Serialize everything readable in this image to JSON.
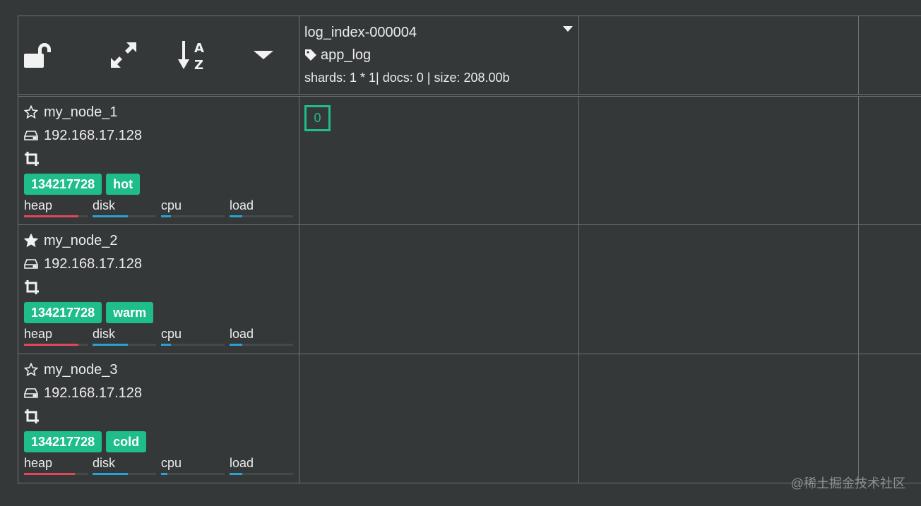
{
  "header": {
    "controls": [
      {
        "icon": "unlock-icon"
      },
      {
        "icon": "expand-icon"
      },
      {
        "icon": "sort-alpha-icon"
      },
      {
        "icon": "caret-down-icon"
      }
    ]
  },
  "index": {
    "name": "log_index-000004",
    "alias": "app_log",
    "stats": "shards: 1 * 1| docs: 0 | size: 208.00b"
  },
  "nodes": [
    {
      "name": "my_node_1",
      "ip": "192.168.17.128",
      "star": "outline",
      "id_badge": "134217728",
      "tier": "hot",
      "metrics": {
        "heap": 0.85,
        "disk": 0.55,
        "cpu": 0.15,
        "load": 0.2
      },
      "shard": "0"
    },
    {
      "name": "my_node_2",
      "ip": "192.168.17.128",
      "star": "filled",
      "id_badge": "134217728",
      "tier": "warm",
      "metrics": {
        "heap": 0.85,
        "disk": 0.55,
        "cpu": 0.15,
        "load": 0.2
      }
    },
    {
      "name": "my_node_3",
      "ip": "192.168.17.128",
      "star": "outline",
      "id_badge": "134217728",
      "tier": "cold",
      "metrics": {
        "heap": 0.8,
        "disk": 0.55,
        "cpu": 0.1,
        "load": 0.2
      }
    }
  ],
  "metric_labels": {
    "heap": "heap",
    "disk": "disk",
    "cpu": "cpu",
    "load": "load"
  },
  "colors": {
    "heap": "#e0485a",
    "disk": "#2aa0d4",
    "cpu": "#2aa0d4",
    "load": "#2aa0d4",
    "badge": "#1fbd8a"
  },
  "watermark": "@稀土掘金技术社区"
}
